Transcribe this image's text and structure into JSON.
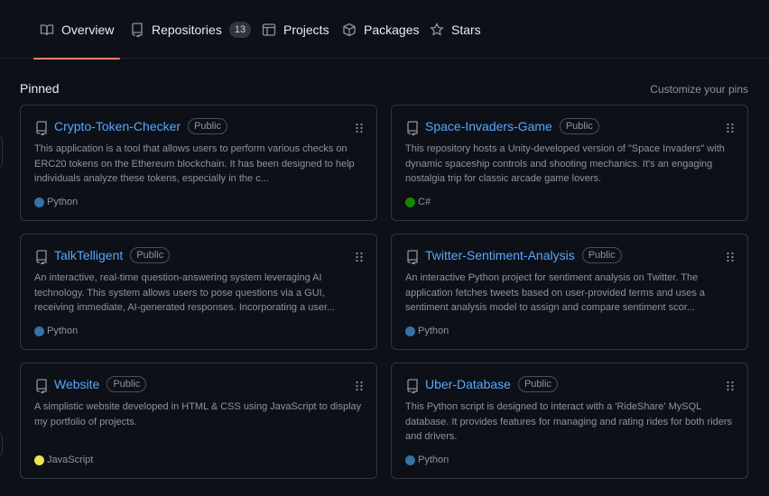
{
  "tabs": [
    {
      "label": "Overview",
      "icon": "book-icon",
      "active": true
    },
    {
      "label": "Repositories",
      "icon": "repo-icon",
      "count": "13"
    },
    {
      "label": "Projects",
      "icon": "project-table-icon"
    },
    {
      "label": "Packages",
      "icon": "package-icon"
    },
    {
      "label": "Stars",
      "icon": "star-icon"
    }
  ],
  "pinned": {
    "title": "Pinned",
    "customize_label": "Customize your pins",
    "repos": [
      {
        "name": "Crypto-Token-Checker",
        "visibility": "Public",
        "description": "This application is a tool that allows users to perform various checks on ERC20 tokens on the Ethereum blockchain. It has been designed to help individuals analyze these tokens, especially in the c...",
        "language": "Python",
        "language_color": "#3572A5"
      },
      {
        "name": "Space-Invaders-Game",
        "visibility": "Public",
        "description": "This repository hosts a Unity-developed version of \"Space Invaders\" with dynamic spaceship controls and shooting mechanics. It's an engaging nostalgia trip for classic arcade game lovers.",
        "language": "C#",
        "language_color": "#178600"
      },
      {
        "name": "TalkTelligent",
        "visibility": "Public",
        "description": "An interactive, real-time question-answering system leveraging AI technology. This system allows users to pose questions via a GUI, receiving immediate, AI-generated responses. Incorporating a user...",
        "language": "Python",
        "language_color": "#3572A5"
      },
      {
        "name": "Twitter-Sentiment-Analysis",
        "visibility": "Public",
        "description": "An interactive Python project for sentiment analysis on Twitter. The application fetches tweets based on user-provided terms and uses a sentiment analysis model to assign and compare sentiment scor...",
        "language": "Python",
        "language_color": "#3572A5"
      },
      {
        "name": "Website",
        "visibility": "Public",
        "description": "A simplistic website developed in HTML & CSS using JavaScript to display my portfolio of projects.",
        "language": "JavaScript",
        "language_color": "#f1e05a"
      },
      {
        "name": "Uber-Database",
        "visibility": "Public",
        "description": "This Python script is designed to interact with a 'RideShare' MySQL database. It provides features for managing and rating rides for both riders and drivers.",
        "language": "Python",
        "language_color": "#3572A5"
      }
    ]
  }
}
